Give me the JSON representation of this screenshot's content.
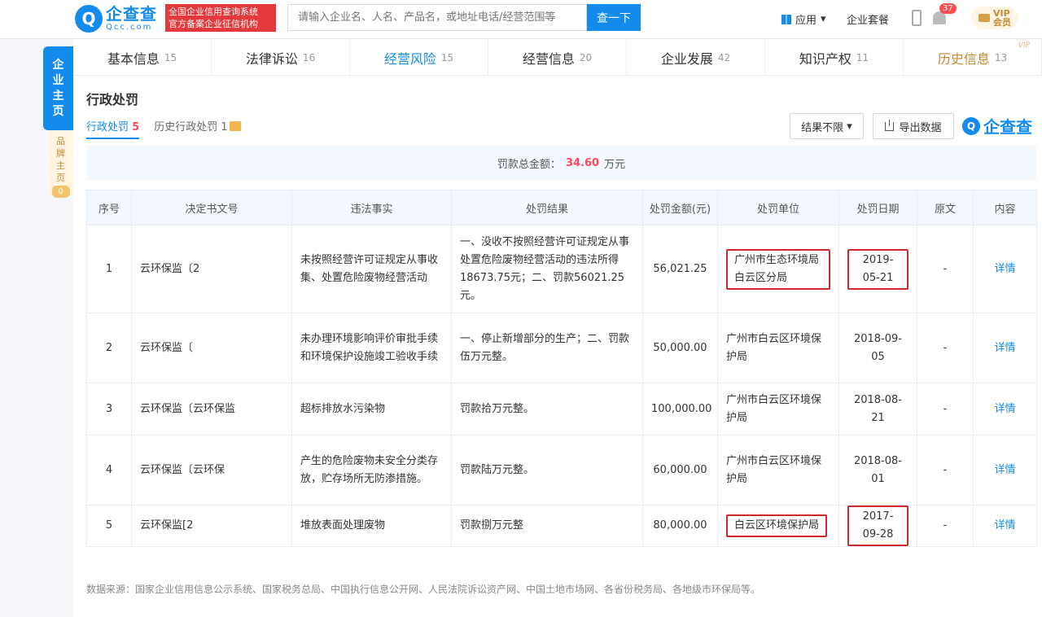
{
  "header": {
    "logo_mark": "Q",
    "logo_name": "企查查",
    "logo_domain": "Qcc.com",
    "slogan_line1": "全国企业信用查询系统",
    "slogan_line2": "官方备案企业征信机构",
    "search_placeholder": "请输入企业名、人名、产品名，或地址电话/经营范围等",
    "search_button": "查一下",
    "app_label": "应用",
    "package_label": "企业套餐",
    "notif_count": "37",
    "vip_line1": "VIP",
    "vip_line2": "会员"
  },
  "side_nav": {
    "main": [
      "企",
      "业",
      "主",
      "页"
    ],
    "brand": [
      "品",
      "牌",
      "主",
      "页"
    ],
    "brand_count": "0"
  },
  "tabs": [
    {
      "label": "基本信息",
      "count": "15"
    },
    {
      "label": "法律诉讼",
      "count": "16"
    },
    {
      "label": "经营风险",
      "count": "15"
    },
    {
      "label": "经营信息",
      "count": "20"
    },
    {
      "label": "企业发展",
      "count": "42"
    },
    {
      "label": "知识产权",
      "count": "11"
    },
    {
      "label": "历史信息",
      "count": "13"
    }
  ],
  "vip_tag": "VIP",
  "section": {
    "title": "行政处罚",
    "subtab_active_label": "行政处罚",
    "subtab_active_count": "5",
    "subtab_history_label": "历史行政处罚",
    "subtab_history_count": "1",
    "filter_label": "结果不限",
    "export_label": "导出数据",
    "brand_mark": "Q",
    "brand_text": "企查查"
  },
  "total": {
    "label": "罚款总金额：",
    "amount": "34.60",
    "unit": "万元"
  },
  "table": {
    "headers": [
      "序号",
      "决定书文号",
      "违法事实",
      "处罚结果",
      "处罚金额(元)",
      "处罚单位",
      "处罚日期",
      "原文",
      "内容"
    ],
    "rows": [
      {
        "no": "1",
        "doc": "云环保监〔2",
        "fact": "未按照经营许可证规定从事收集、处置危险废物经营活动",
        "result": "一、没收不按照经营许可证规定从事处置危险废物经营活动的违法所得18673.75元；二、罚款56021.25元。",
        "amount": "56,021.25",
        "unit": "广州市生态环境局白云区分局",
        "date": "2019-05-21",
        "orig": "-",
        "detail": "详情"
      },
      {
        "no": "2",
        "doc": "云环保监〔",
        "fact": "未办理环境影响评价审批手续和环境保护设施竣工验收手续",
        "result": "一、停止新增部分的生产；二、罚款伍万元整。",
        "amount": "50,000.00",
        "unit": "广州市白云区环境保护局",
        "date": "2018-09-05",
        "orig": "-",
        "detail": "详情"
      },
      {
        "no": "3",
        "doc": "云环保监〔云环保监",
        "fact": "超标排放水污染物",
        "result": "罚款拾万元整。",
        "amount": "100,000.00",
        "unit": "广州市白云区环境保护局",
        "date": "2018-08-21",
        "orig": "-",
        "detail": "详情"
      },
      {
        "no": "4",
        "doc": "云环保监〔云环保",
        "fact": "产生的危险废物未安全分类存放，贮存场所无防渗措施。",
        "result": "罚款陆万元整。",
        "amount": "60,000.00",
        "unit": "广州市白云区环境保护局",
        "date": "2018-08-01",
        "orig": "-",
        "detail": "详情"
      },
      {
        "no": "5",
        "doc": "云环保监[2",
        "fact": "堆放表面处理废物",
        "result": "罚款捌万元整",
        "amount": "80,000.00",
        "unit": "白云区环境保护局",
        "date": "2017-09-28",
        "orig": "-",
        "detail": "详情"
      }
    ]
  },
  "footer": {
    "source": "数据来源：国家企业信用信息公示系统、国家税务总局、中国执行信息公开网、人民法院诉讼资产网、中国土地市场网、各省份税务局、各地级市环保局等。"
  },
  "colors": {
    "brand_blue": "#128bed",
    "highlight_red": "#d0282d",
    "amount_red": "#fd485e",
    "vip_gold": "#c48a32"
  }
}
